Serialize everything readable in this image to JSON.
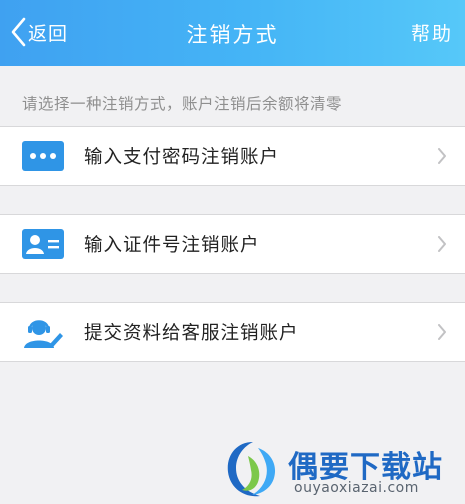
{
  "nav": {
    "back_label": "返回",
    "title": "注销方式",
    "help_label": "帮助"
  },
  "notice": "请选择一种注销方式，账户注销后余额将清零",
  "options": [
    {
      "label": "输入支付密码注销账户",
      "icon": "password-keypad-icon"
    },
    {
      "label": "输入证件号注销账户",
      "icon": "id-card-icon"
    },
    {
      "label": "提交资料给客服注销账户",
      "icon": "customer-service-icon"
    }
  ],
  "watermark": {
    "title": "偶要下载站",
    "url": "ouyaoxiazai.com"
  },
  "colors": {
    "nav_gradient_start": "#3fa1f1",
    "nav_gradient_end": "#56c8f9",
    "icon_blue": "#2f95e6",
    "background": "#f1f1f3"
  }
}
